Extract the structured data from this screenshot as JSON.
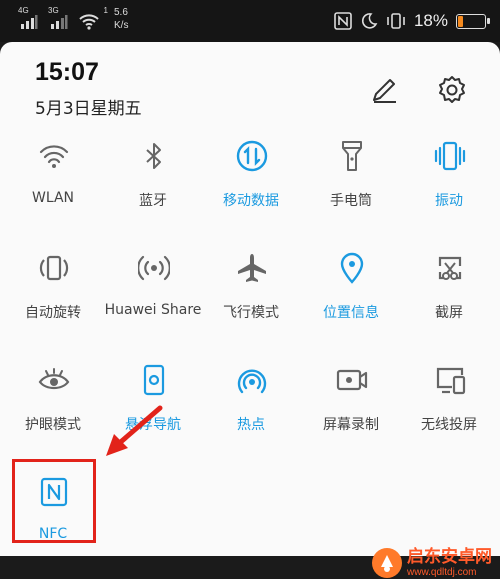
{
  "status_bar": {
    "sim1_label": "4G",
    "sim2_label": "3G",
    "wifi_label": "1",
    "speed_value": "5.6",
    "speed_unit": "K/s",
    "battery_percent": "18%",
    "battery_level": 0.18,
    "battery_color": "#f58a1f"
  },
  "header": {
    "time": "15:07",
    "date": "5月3日星期五"
  },
  "accent_color": "#1b9ae0",
  "tiles": [
    {
      "label": "WLAN",
      "icon": "wifi-icon",
      "active": false
    },
    {
      "label": "蓝牙",
      "icon": "bluetooth-icon",
      "active": false
    },
    {
      "label": "移动数据",
      "icon": "mobile-data-icon",
      "active": true
    },
    {
      "label": "手电筒",
      "icon": "flashlight-icon",
      "active": false
    },
    {
      "label": "振动",
      "icon": "vibrate-icon",
      "active": true
    },
    {
      "label": "自动旋转",
      "icon": "auto-rotate-icon",
      "active": false
    },
    {
      "label": "Huawei Share",
      "icon": "huawei-share-icon",
      "active": false
    },
    {
      "label": "飞行模式",
      "icon": "airplane-icon",
      "active": false
    },
    {
      "label": "位置信息",
      "icon": "location-icon",
      "active": true
    },
    {
      "label": "截屏",
      "icon": "screenshot-icon",
      "active": false
    },
    {
      "label": "护眼模式",
      "icon": "eye-icon",
      "active": false
    },
    {
      "label": "悬浮导航",
      "icon": "floating-dock-icon",
      "active": true
    },
    {
      "label": "热点",
      "icon": "hotspot-icon",
      "active": true
    },
    {
      "label": "屏幕录制",
      "icon": "screen-record-icon",
      "active": false
    },
    {
      "label": "无线投屏",
      "icon": "wireless-projection-icon",
      "active": false
    },
    {
      "label": "NFC",
      "icon": "nfc-icon",
      "active": true
    }
  ],
  "watermark": {
    "title": "启东安卓网",
    "url": "www.qdltdj.com"
  }
}
